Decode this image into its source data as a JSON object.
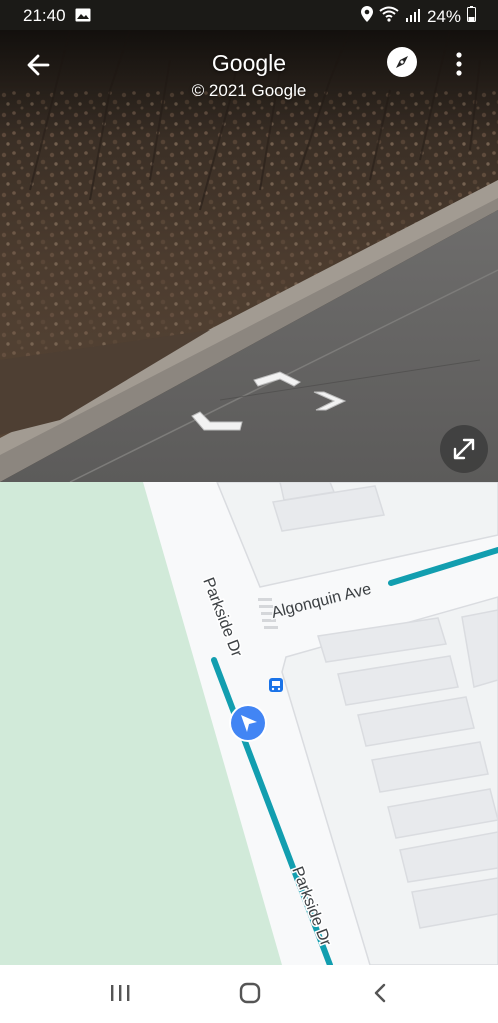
{
  "status_bar": {
    "time": "21:40",
    "battery": "24%",
    "icons": [
      "gallery-icon",
      "location-icon",
      "wifi-icon",
      "signal-icon",
      "battery-icon"
    ]
  },
  "street_view": {
    "title": "Google",
    "copyright": "© 2021 Google",
    "icons": [
      "back-arrow-icon",
      "compass-icon",
      "more-vert-icon",
      "expand-icon"
    ]
  },
  "map": {
    "streets": {
      "algonquin": "Algonquin Ave",
      "parkside_1": "Parkside Dr",
      "parkside_2": "Parkside Dr"
    },
    "colors": {
      "park": "#d1ead9",
      "route": "#129eaf",
      "location": "#4285f4",
      "transit": "#1a73e8"
    }
  },
  "nav_bar": {
    "icons": [
      "recent-apps-icon",
      "home-icon",
      "back-icon"
    ]
  }
}
